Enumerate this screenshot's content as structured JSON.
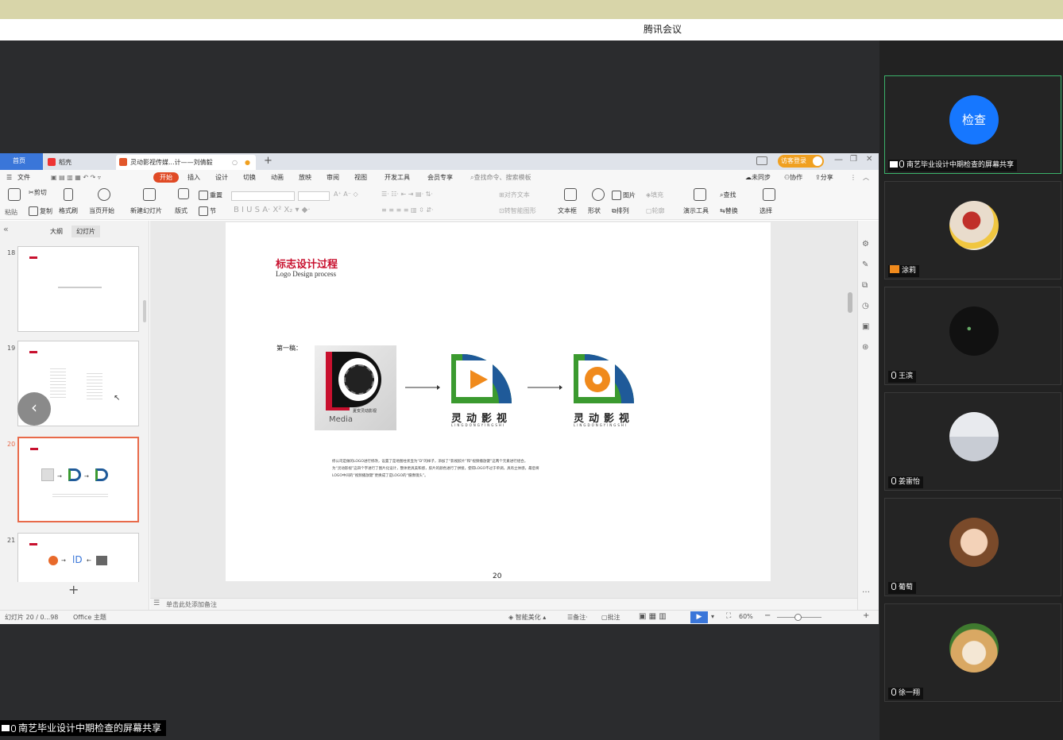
{
  "app_title": "腾讯会议",
  "share_label": "南艺毕业设计中期检查的屏幕共享",
  "wps": {
    "tabs": {
      "home": "首页",
      "daoke": "稻壳",
      "doc": "灵动影视传媒...计——刘倩毅"
    },
    "login_btn": "访客登录",
    "ribbon_tabs": [
      "文件",
      "开始",
      "插入",
      "设计",
      "切换",
      "动画",
      "放映",
      "审阅",
      "视图",
      "开发工具",
      "会员专享"
    ],
    "search_placeholder": "查找命令、搜索模板",
    "top_right": {
      "sync": "未同步",
      "collab": "协作",
      "share": "分享"
    },
    "ribbon": {
      "paste": "粘贴",
      "cut": "剪切",
      "copy": "复制",
      "format_painter": "格式刷",
      "from_current": "当页开始",
      "new_slide": "新建幻灯片",
      "layout": "版式",
      "reset": "重置",
      "section": "节",
      "align_text": "对齐文本",
      "smartart": "转智能图形",
      "textbox": "文本框",
      "shape": "形状",
      "picture": "图片",
      "fill": "填充",
      "arrange": "排列",
      "outline": "轮廓",
      "presenter": "演示工具",
      "find": "查找",
      "replace": "替换",
      "select": "选择"
    },
    "left_tabs": {
      "outline": "大纲",
      "slides": "幻灯片"
    },
    "thumb_numbers": [
      "18",
      "19",
      "20",
      "21"
    ],
    "notes_placeholder": "单击此处添加备注",
    "status": {
      "slide_info": "幻灯片 20 / 0...98",
      "theme": "Office 主题",
      "beautify": "智能美化",
      "notes": "备注",
      "comment": "批注",
      "zoom": "60%"
    }
  },
  "slide": {
    "title": "标志设计过程",
    "subtitle": "Logo Design process",
    "draft_label": "第一稿：",
    "media_text": "Media",
    "media_sub": "夏安灵动影视",
    "brand_name": "灵动影视",
    "brand_pinyin": "LINGDONGYINGSHI",
    "body_lines": [
      "修公司是做的LOGO进行修改，设置了是地图柱状显为“D”的样子，添加了“影视胶片”和“视频播放键”这两个元素进行组合。",
      "为“灵动影视”这四个字进行了图片化设计，整体更具美和感，胶片的颜色进行了拼接，使得LOGO不过于单调，具有立体感，最后将",
      "LOGO中间的“视频播放键”更换成了是LOGO的“摄像镜头”。"
    ],
    "page_number": "20",
    "colors": {
      "title_red": "#c8102e",
      "blue": "#1f5a99",
      "green": "#3b9a2f",
      "orange": "#f08a1c"
    }
  },
  "participants": [
    {
      "name": "南艺毕业设计中期检查的屏幕共享",
      "avatar_text": "检查",
      "avatar_color": "#1677ff"
    },
    {
      "name": "涂莉",
      "avatar": "rose-avatar"
    },
    {
      "name": "王滨",
      "avatar": "cat-avatar"
    },
    {
      "name": "姜雷怡",
      "avatar": "room-avatar"
    },
    {
      "name": "葡萄",
      "avatar": "girl-avatar"
    },
    {
      "name": "徐一翔",
      "avatar": "dog-avatar"
    }
  ]
}
